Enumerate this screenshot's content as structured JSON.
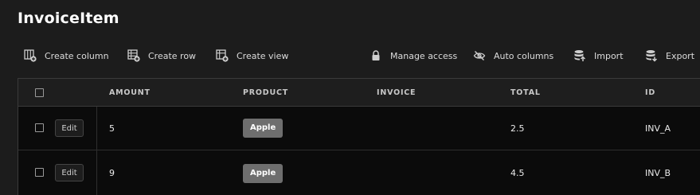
{
  "page": {
    "title": "InvoiceItem"
  },
  "toolbar": {
    "create_column": "Create column",
    "create_row": "Create row",
    "create_view": "Create view",
    "manage_access": "Manage access",
    "auto_columns": "Auto columns",
    "import": "Import",
    "export": "Export"
  },
  "table": {
    "columns": [
      "AMOUNT",
      "PRODUCT",
      "INVOICE",
      "TOTAL",
      "ID"
    ],
    "edit_label": "Edit",
    "rows": [
      {
        "amount": "5",
        "product": "Apple",
        "invoice": "",
        "total": "2.5",
        "id": "INV_A"
      },
      {
        "amount": "9",
        "product": "Apple",
        "invoice": "",
        "total": "4.5",
        "id": "INV_B"
      }
    ]
  },
  "colors": {
    "background": "#1c1c1c",
    "row_background": "#0b0b0b",
    "tag_background": "#6e6e6e",
    "text": "#e8e8e8"
  }
}
